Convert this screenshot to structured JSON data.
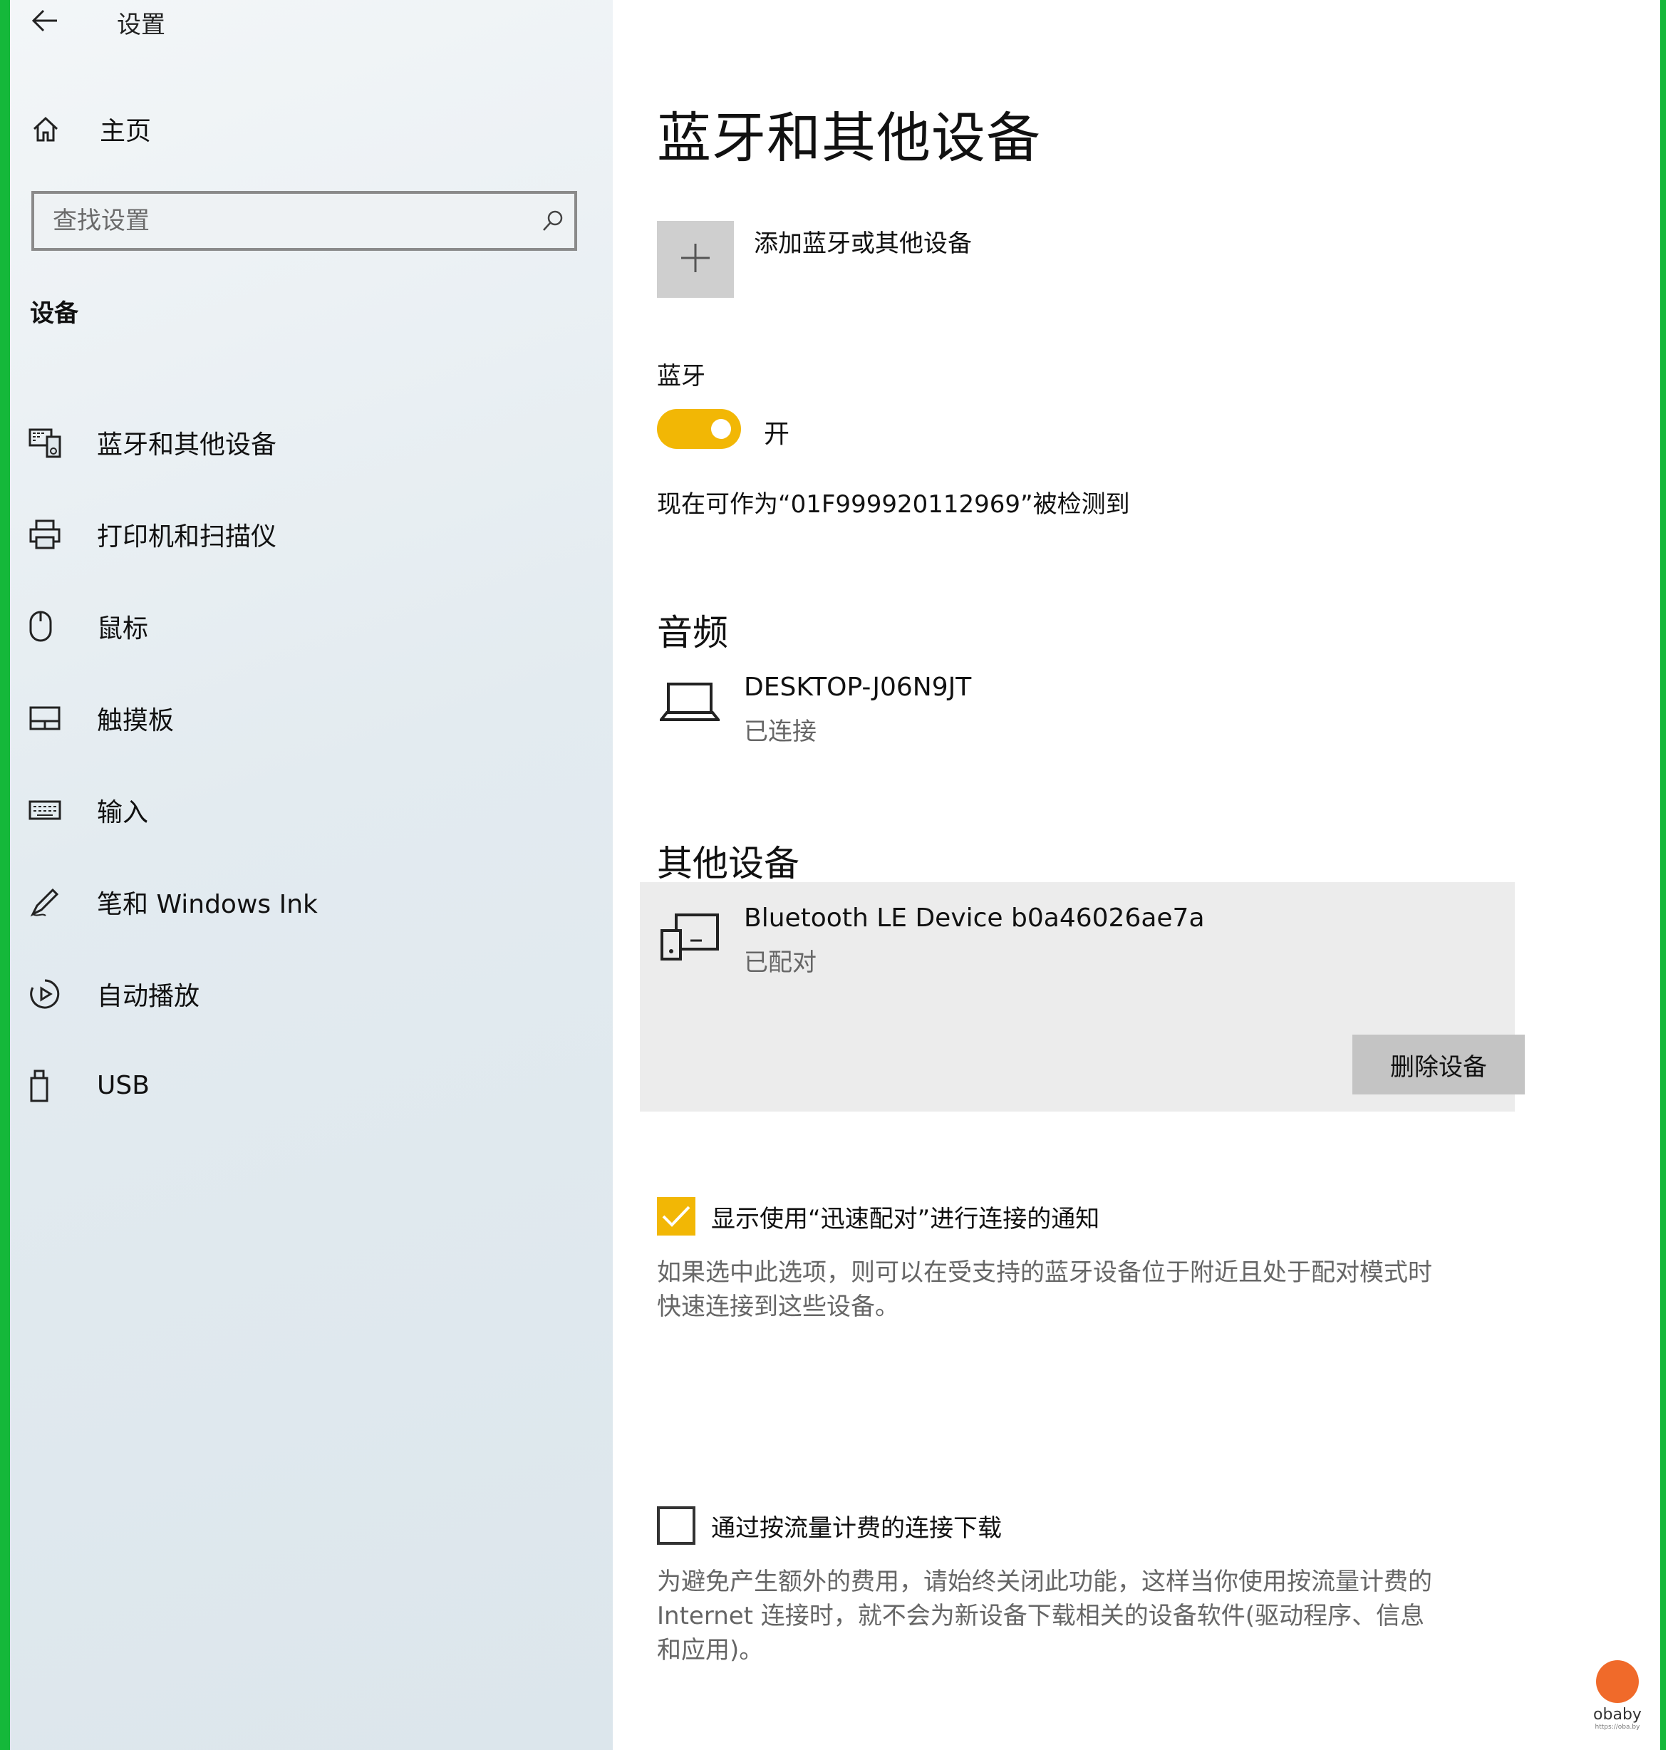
{
  "window": {
    "title": "设置"
  },
  "sidebar": {
    "home_label": "主页",
    "search_placeholder": "查找设置",
    "section_title": "设备",
    "items": [
      {
        "label": "蓝牙和其他设备",
        "icon": "bluetooth-devices-icon"
      },
      {
        "label": "打印机和扫描仪",
        "icon": "printer-icon"
      },
      {
        "label": "鼠标",
        "icon": "mouse-icon"
      },
      {
        "label": "触摸板",
        "icon": "touchpad-icon"
      },
      {
        "label": "输入",
        "icon": "keyboard-icon"
      },
      {
        "label": "笔和 Windows Ink",
        "icon": "pen-icon"
      },
      {
        "label": "自动播放",
        "icon": "autoplay-icon"
      },
      {
        "label": "USB",
        "icon": "usb-icon"
      }
    ]
  },
  "main": {
    "title": "蓝牙和其他设备",
    "add_device_label": "添加蓝牙或其他设备",
    "bluetooth": {
      "label": "蓝牙",
      "state_label": "开",
      "discoverable_text": "现在可作为“01F999920112969”被检测到"
    },
    "audio": {
      "heading": "音频",
      "device": {
        "name": "DESKTOP-J06N9JT",
        "status": "已连接"
      }
    },
    "other": {
      "heading": "其他设备",
      "device": {
        "name": "Bluetooth LE Device b0a46026ae7a",
        "status": "已配对"
      },
      "remove_label": "删除设备"
    },
    "swift_pair": {
      "label": "显示使用“迅速配对”进行连接的通知",
      "checked": true,
      "description_line1": "如果选中此选项，则可以在受支持的蓝牙设备位于附近且处于配对模式时",
      "description_line2": "快速连接到这些设备。"
    },
    "metered": {
      "label": "通过按流量计费的连接下载",
      "checked": false,
      "description_line1": "为避免产生额外的费用，请始终关闭此功能，这样当你使用按流量计费的",
      "description_line2": "Internet 连接时，就不会为新设备下载相关的设备软件(驱动程序、信息",
      "description_line3": "和应用)。"
    }
  },
  "logo": {
    "text": "obaby",
    "sub": "https://oba.by"
  },
  "colors": {
    "accent": "#f2b705",
    "frame": "#15b83a"
  }
}
